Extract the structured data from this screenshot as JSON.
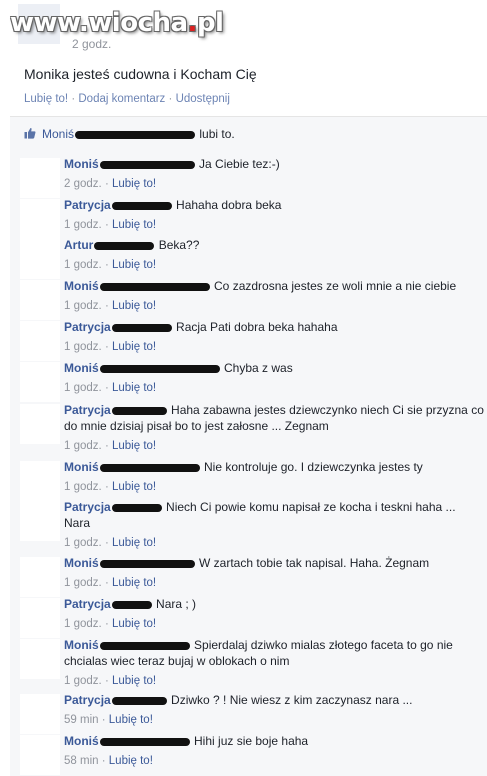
{
  "watermark": {
    "prefix": "www.",
    "brand": "wiocha",
    "dot": ".",
    "tld": "pl"
  },
  "post": {
    "time": "2 godz.",
    "text": "Monika jesteś cudowna i Kocham Cię",
    "actions": [
      "Lubię to!",
      "Dodaj komentarz",
      "Udostępnij"
    ],
    "separator": "·"
  },
  "likes": {
    "icon": "thumbs-up-icon",
    "name": "Moniś",
    "suffix": "lubi to."
  },
  "comments": [
    {
      "author": "Moniś",
      "text": "Ja Ciebie tez:-)",
      "time": "2 godz.",
      "like": "Lubię to!"
    },
    {
      "author": "Patrycja",
      "text": "Hahaha dobra beka",
      "time": "1 godz.",
      "like": "Lubię to!"
    },
    {
      "author": "Artur",
      "text": "Beka??",
      "time": "1 godz.",
      "like": "Lubię to!"
    },
    {
      "author": "Moniś",
      "text": "Co zazdrosna jestes ze woli mnie a nie ciebie",
      "time": "1 godz.",
      "like": "Lubię to!"
    },
    {
      "author": "Patrycja",
      "text": "Racja Pati dobra beka hahaha",
      "time": "1 godz.",
      "like": "Lubię to!"
    },
    {
      "author": "Moniś",
      "text": "Chyba z was",
      "time": "1 godz.",
      "like": "Lubię to!"
    },
    {
      "author": "Patrycja",
      "text": "Haha zabawna jestes dziewczynko niech Ci sie przyzna co do mnie dzisiaj pisał bo to jest załosne ... Zegnam",
      "time": "1 godz.",
      "like": "Lubię to!"
    },
    {
      "author": "Moniś",
      "text": "Nie kontroluje go. I dziewczynka jestes ty",
      "time": "1 godz.",
      "like": "Lubię to!"
    },
    {
      "author": "Patrycja",
      "text": "Niech Ci powie komu napisał ze kocha i teskni haha ... Nara",
      "time": "1 godz.",
      "like": "Lubię to!"
    },
    {
      "author": "Moniś",
      "text": "W zartach tobie tak napisal. Haha. Żegnam",
      "time": "1 godz.",
      "like": "Lubię to!"
    },
    {
      "author": "Patrycja",
      "text": "Nara ; )",
      "time": "1 godz.",
      "like": "Lubię to!"
    },
    {
      "author": "Moniś",
      "text": "Spierdalaj dziwko mialas złotego faceta to go nie chcialas wiec teraz bujaj w oblokach o nim",
      "time": "1 godz.",
      "like": "Lubię to!"
    },
    {
      "author": "Patrycja",
      "text": "Dziwko ? ! Nie wiesz z kim zaczynasz nara ...",
      "time": "59 min",
      "like": "Lubię to!"
    },
    {
      "author": "Moniś",
      "text": "Hihi juz sie boje haha",
      "time": "58 min",
      "like": "Lubię to!"
    }
  ]
}
